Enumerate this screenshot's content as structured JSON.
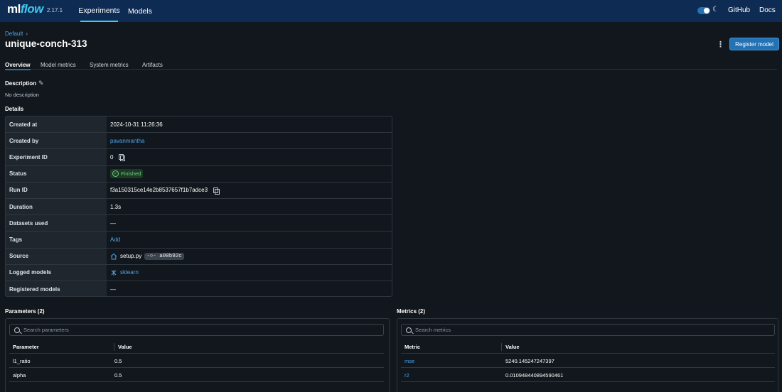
{
  "header": {
    "logo_ml": "ml",
    "logo_flow": "flow",
    "version": "2.17.1",
    "nav": [
      "Experiments",
      "Models"
    ],
    "links": [
      "GitHub",
      "Docs"
    ],
    "accent": "#43c9ed",
    "background": "#0e2b53"
  },
  "page": {
    "breadcrumb": "Default",
    "breadcrumb_sep": "›",
    "title": "unique-conch-313",
    "register_button": "Register model",
    "tabs": [
      "Overview",
      "Model metrics",
      "System metrics",
      "Artifacts"
    ],
    "description_title": "Description",
    "description_text": "No description",
    "details_title": "Details"
  },
  "details": {
    "created_at_label": "Created at",
    "created_at": "2024-10-31 11:26:36",
    "created_by_label": "Created by",
    "created_by": "pavanmantha",
    "experiment_id_label": "Experiment ID",
    "experiment_id": "0",
    "status_label": "Status",
    "status": "Finished",
    "run_id_label": "Run ID",
    "run_id": "f3a150315ce14e2b8537657f1b7adce3",
    "duration_label": "Duration",
    "duration": "1.3s",
    "datasets_label": "Datasets used",
    "datasets": "—",
    "tags_label": "Tags",
    "tags": "Add",
    "source_label": "Source",
    "source": "setup.py",
    "commit": "a00b92c",
    "logged_models_label": "Logged models",
    "logged_models": "sklearn",
    "registered_models_label": "Registered models",
    "registered_models": "—"
  },
  "parameters": {
    "title": "Parameters (2)",
    "search_placeholder": "Search parameters",
    "col_name": "Parameter",
    "col_value": "Value",
    "rows": [
      {
        "name": "l1_ratio",
        "value": "0.5"
      },
      {
        "name": "alpha",
        "value": "0.5"
      }
    ]
  },
  "metrics": {
    "title": "Metrics (2)",
    "search_placeholder": "Search metrics",
    "col_name": "Metric",
    "col_value": "Value",
    "rows": [
      {
        "name": "mse",
        "value": "5240.145247247397"
      },
      {
        "name": "r2",
        "value": "0.010948440894590461"
      }
    ]
  }
}
